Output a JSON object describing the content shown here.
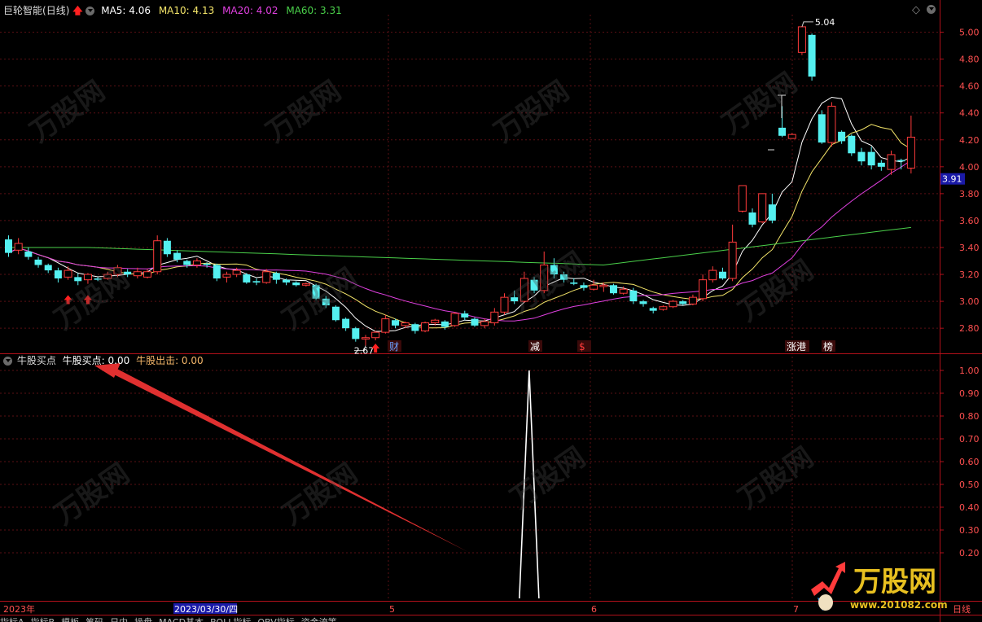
{
  "stock": {
    "name": "巨轮智能",
    "period": "(日线)"
  },
  "ma_legend": [
    {
      "label": "MA5: 4.06",
      "color": "#ffffff"
    },
    {
      "label": "MA10: 4.13",
      "color": "#f5e66a"
    },
    {
      "label": "MA20: 4.02",
      "color": "#e040e0"
    },
    {
      "label": "MA60: 3.31",
      "color": "#4ad04a"
    }
  ],
  "indicator_legend": {
    "title": "牛股买点",
    "buy_label": "牛股买点: 0.00",
    "sell_label": "牛股出击: 0.00"
  },
  "colors": {
    "up": "#ff3b3b",
    "down": "#54f0f0",
    "frame": "#b0101a",
    "grid": "#5a0f14",
    "axis_text": "#ff5050"
  },
  "price_axis": {
    "ticks": [
      "5.00",
      "4.80",
      "4.60",
      "4.40",
      "4.20",
      "4.00",
      "3.80",
      "3.60",
      "3.40",
      "3.20",
      "3.00",
      "2.80"
    ],
    "current": "3.91"
  },
  "indicator_axis": {
    "ticks": [
      "1.00",
      "0.90",
      "0.80",
      "0.70",
      "0.60",
      "0.50",
      "0.40",
      "0.30",
      "0.20"
    ]
  },
  "annotations": {
    "high": "5.04",
    "low": "2.67"
  },
  "event_tags": [
    {
      "text": "财",
      "x": 478,
      "color": "#6aa0ff"
    },
    {
      "text": "减",
      "x": 651,
      "color": "#ffffff"
    },
    {
      "text": "$",
      "x": 711,
      "color": "#ff3b3b"
    },
    {
      "text": "涨港",
      "x": 966,
      "color": "#ffffff"
    },
    {
      "text": "榜",
      "x": 1011,
      "color": "#ffffff"
    }
  ],
  "date_axis": {
    "labels": [
      {
        "text": "2023年",
        "x": 4
      },
      {
        "text": "2023/03/30/四",
        "x": 214,
        "highlight": true
      },
      {
        "text": "5",
        "x": 478
      },
      {
        "text": "6",
        "x": 726
      },
      {
        "text": "7",
        "x": 974
      },
      {
        "text": "日线",
        "x": 1170
      }
    ]
  },
  "bottom_tabs": [
    "指标A",
    "指标B",
    "模板",
    "筹码",
    "日内",
    "操盘",
    "MACD基本",
    "BOLL指标",
    "OBV指标",
    "资金流等"
  ],
  "watermark": {
    "brand": "万股网",
    "url": "www.201082.com"
  },
  "chart_data": {
    "type": "candlestick",
    "ylim": [
      2.68,
      5.1
    ],
    "candles": [
      [
        3.46,
        3.36,
        3.49,
        3.33
      ],
      [
        3.38,
        3.43,
        3.47,
        3.35
      ],
      [
        3.37,
        3.33,
        3.4,
        3.31
      ],
      [
        3.31,
        3.27,
        3.33,
        3.25
      ],
      [
        3.27,
        3.23,
        3.28,
        3.21
      ],
      [
        3.23,
        3.17,
        3.25,
        3.14
      ],
      [
        3.18,
        3.23,
        3.26,
        3.16
      ],
      [
        3.18,
        3.15,
        3.21,
        3.12
      ],
      [
        3.16,
        3.2,
        3.21,
        3.13
      ],
      [
        3.17,
        3.16,
        3.18,
        3.15
      ],
      [
        3.17,
        3.2,
        3.22,
        3.16
      ],
      [
        3.2,
        3.25,
        3.27,
        3.18
      ],
      [
        3.22,
        3.2,
        3.24,
        3.18
      ],
      [
        3.19,
        3.22,
        3.25,
        3.17
      ],
      [
        3.18,
        3.22,
        3.24,
        3.17
      ],
      [
        3.22,
        3.45,
        3.49,
        3.2
      ],
      [
        3.45,
        3.35,
        3.47,
        3.33
      ],
      [
        3.36,
        3.31,
        3.38,
        3.29
      ],
      [
        3.3,
        3.27,
        3.31,
        3.25
      ],
      [
        3.27,
        3.3,
        3.32,
        3.25
      ],
      [
        3.28,
        3.27,
        3.29,
        3.25
      ],
      [
        3.27,
        3.17,
        3.28,
        3.15
      ],
      [
        3.18,
        3.2,
        3.22,
        3.14
      ],
      [
        3.2,
        3.23,
        3.25,
        3.18
      ],
      [
        3.2,
        3.14,
        3.21,
        3.13
      ],
      [
        3.15,
        3.14,
        3.17,
        3.12
      ],
      [
        3.14,
        3.22,
        3.24,
        3.13
      ],
      [
        3.21,
        3.16,
        3.22,
        3.13
      ],
      [
        3.16,
        3.14,
        3.17,
        3.12
      ],
      [
        3.14,
        3.12,
        3.15,
        3.11
      ],
      [
        3.12,
        3.13,
        3.14,
        3.11
      ],
      [
        3.12,
        3.02,
        3.13,
        3.01
      ],
      [
        3.02,
        2.97,
        3.04,
        2.95
      ],
      [
        2.96,
        2.86,
        2.97,
        2.85
      ],
      [
        2.87,
        2.8,
        2.88,
        2.78
      ],
      [
        2.8,
        2.72,
        2.81,
        2.7
      ],
      [
        2.72,
        2.73,
        2.75,
        2.67
      ],
      [
        2.73,
        2.77,
        2.78,
        2.71
      ],
      [
        2.77,
        2.87,
        2.9,
        2.76
      ],
      [
        2.86,
        2.82,
        2.87,
        2.8
      ],
      [
        2.82,
        2.84,
        2.85,
        2.8
      ],
      [
        2.83,
        2.78,
        2.84,
        2.76
      ],
      [
        2.78,
        2.84,
        2.85,
        2.77
      ],
      [
        2.84,
        2.86,
        2.87,
        2.82
      ],
      [
        2.85,
        2.81,
        2.86,
        2.79
      ],
      [
        2.82,
        2.91,
        2.92,
        2.81
      ],
      [
        2.91,
        2.88,
        2.93,
        2.86
      ],
      [
        2.87,
        2.82,
        2.88,
        2.81
      ],
      [
        2.82,
        2.85,
        2.87,
        2.8
      ],
      [
        2.84,
        2.92,
        2.95,
        2.82
      ],
      [
        2.92,
        3.03,
        3.06,
        2.9
      ],
      [
        3.03,
        3.0,
        3.08,
        2.98
      ],
      [
        3.0,
        3.17,
        3.22,
        2.99
      ],
      [
        3.16,
        3.08,
        3.18,
        3.06
      ],
      [
        3.08,
        3.27,
        3.37,
        3.06
      ],
      [
        3.27,
        3.2,
        3.32,
        3.17
      ],
      [
        3.2,
        3.16,
        3.22,
        3.14
      ],
      [
        3.14,
        3.13,
        3.17,
        3.12
      ],
      [
        3.12,
        3.1,
        3.14,
        3.08
      ],
      [
        3.09,
        3.12,
        3.16,
        3.08
      ],
      [
        3.11,
        3.12,
        3.14,
        3.07
      ],
      [
        3.12,
        3.06,
        3.13,
        3.05
      ],
      [
        3.06,
        3.09,
        3.11,
        3.05
      ],
      [
        3.08,
        3.0,
        3.1,
        2.98
      ],
      [
        3.0,
        2.98,
        3.01,
        2.96
      ],
      [
        2.95,
        2.93,
        2.96,
        2.91
      ],
      [
        2.94,
        2.96,
        2.97,
        2.93
      ],
      [
        2.96,
        3.0,
        3.01,
        2.95
      ],
      [
        3.0,
        2.98,
        3.01,
        2.97
      ],
      [
        2.98,
        3.03,
        3.05,
        2.97
      ],
      [
        3.02,
        3.16,
        3.2,
        3.0
      ],
      [
        3.16,
        3.23,
        3.26,
        3.14
      ],
      [
        3.22,
        3.17,
        3.25,
        3.16
      ],
      [
        3.17,
        3.44,
        3.57,
        3.15
      ],
      [
        3.67,
        3.86,
        3.86,
        3.66
      ],
      [
        3.66,
        3.57,
        3.69,
        3.55
      ],
      [
        3.59,
        3.8,
        3.8,
        3.58
      ],
      [
        3.72,
        3.6,
        3.8,
        3.58
      ],
      [
        4.29,
        4.23,
        4.45,
        4.22
      ],
      [
        4.21,
        4.24,
        4.25,
        4.21
      ],
      [
        4.85,
        5.04,
        5.04,
        4.83
      ],
      [
        4.98,
        4.67,
        4.99,
        4.64
      ],
      [
        4.39,
        4.18,
        4.42,
        4.17
      ],
      [
        4.18,
        4.45,
        4.48,
        4.15
      ],
      [
        4.26,
        4.19,
        4.27,
        4.17
      ],
      [
        4.23,
        4.1,
        4.24,
        4.08
      ],
      [
        4.11,
        4.04,
        4.14,
        4.01
      ],
      [
        4.11,
        4.01,
        4.15,
        3.98
      ],
      [
        4.03,
        4.0,
        4.05,
        3.97
      ],
      [
        3.98,
        4.09,
        4.12,
        3.94
      ],
      [
        4.05,
        4.04,
        4.06,
        3.98
      ],
      [
        3.99,
        4.22,
        4.38,
        3.95
      ]
    ],
    "indicator": {
      "name": "牛股买点",
      "ylim": [
        0.0,
        1.0
      ],
      "pulse_at_candle": 52,
      "value": 1.0
    }
  }
}
